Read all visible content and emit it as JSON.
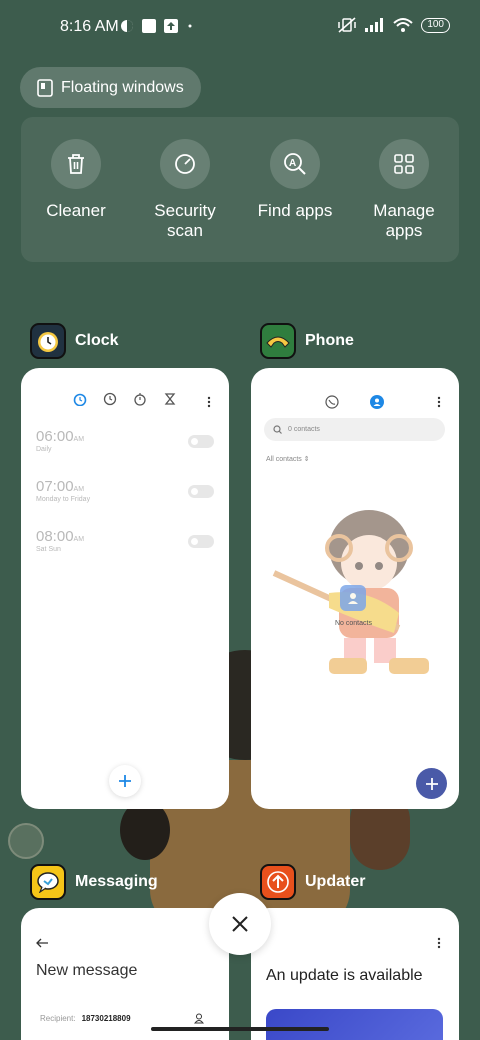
{
  "status_bar": {
    "time": "8:16 AM",
    "battery": "100"
  },
  "floating_windows": {
    "label": "Floating windows"
  },
  "tools": [
    {
      "label": "Cleaner",
      "icon": "trash-icon"
    },
    {
      "label": "Security\nscan",
      "icon": "security-scan-icon"
    },
    {
      "label": "Find apps",
      "icon": "find-apps-icon"
    },
    {
      "label": "Manage\napps",
      "icon": "grid-icon"
    }
  ],
  "apps": {
    "clock": {
      "name": "Clock",
      "alarms": [
        {
          "time": "06:00",
          "ampm": "AM",
          "repeat": "Daily"
        },
        {
          "time": "07:00",
          "ampm": "AM",
          "repeat": "Monday to Friday"
        },
        {
          "time": "08:00",
          "ampm": "AM",
          "repeat": "Sat Sun"
        }
      ]
    },
    "phone": {
      "name": "Phone",
      "search_placeholder": "0 contacts",
      "filter": "All contacts",
      "empty_text": "No contacts"
    },
    "messaging": {
      "name": "Messaging",
      "title": "New message",
      "recipient_label": "Recipient:",
      "recipient_value": "18730218809"
    },
    "updater": {
      "name": "Updater",
      "title": "An update is available"
    }
  },
  "colors": {
    "background": "#3d5c4d",
    "accent_blue": "#1e88e5",
    "phone_fab": "#4a5aa8",
    "updater_orange": "#e8501c",
    "messaging_yellow": "#f5c518"
  }
}
